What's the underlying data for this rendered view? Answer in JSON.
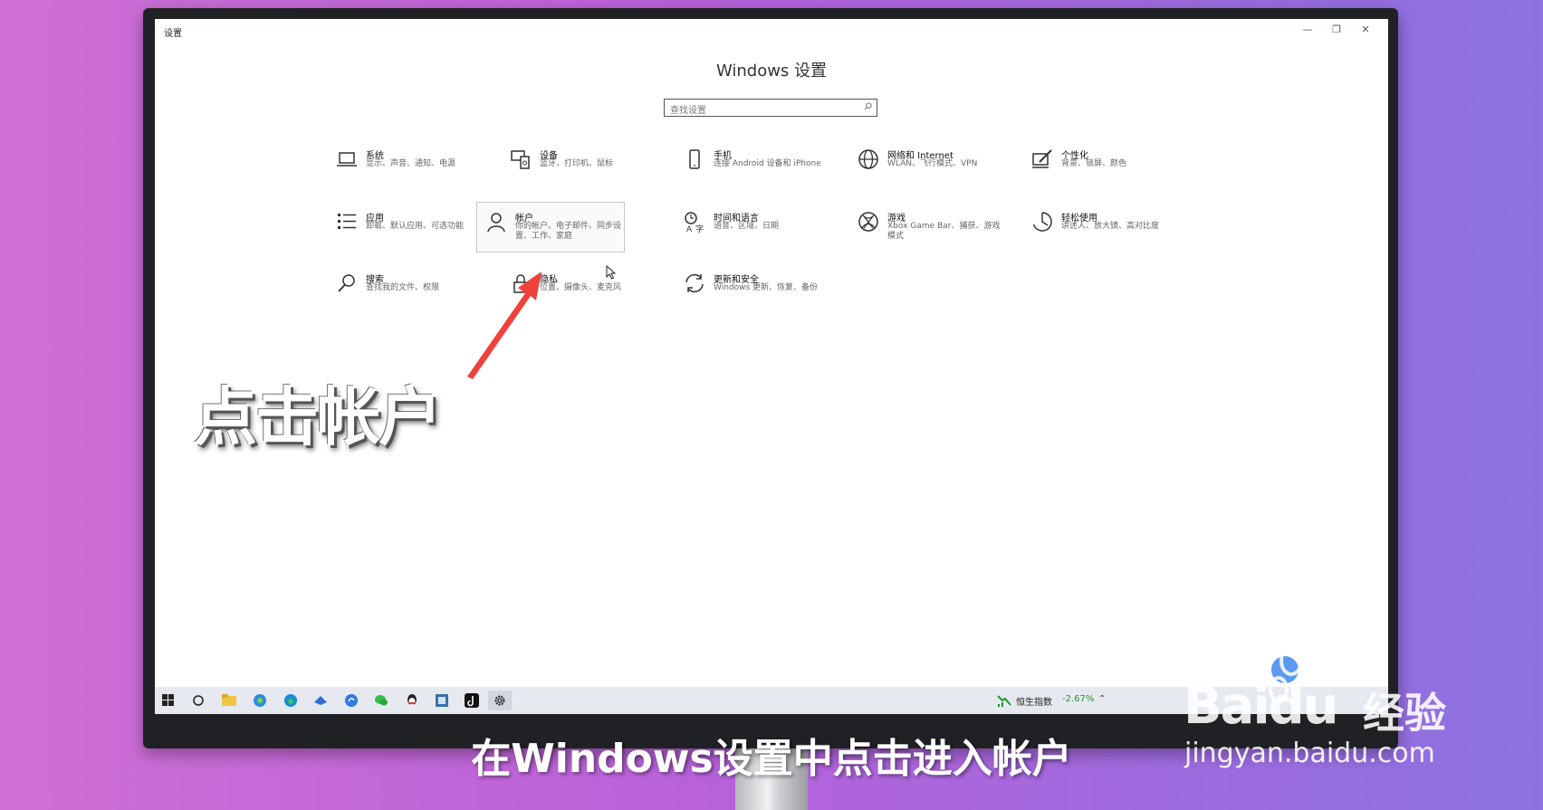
{
  "window": {
    "title": "设置",
    "heading": "Windows 设置",
    "minimize": "—",
    "maximize": "❐",
    "close": "✕"
  },
  "search": {
    "placeholder": "查找设置"
  },
  "tiles": [
    {
      "title": "系统",
      "desc": "显示、声音、通知、电源",
      "icon": "laptop-icon"
    },
    {
      "title": "设备",
      "desc": "蓝牙、打印机、鼠标",
      "icon": "devices-icon"
    },
    {
      "title": "手机",
      "desc": "连接 Android 设备和 iPhone",
      "icon": "phone-icon"
    },
    {
      "title": "网络和 Internet",
      "desc": "WLAN、飞行模式、VPN",
      "icon": "globe-icon"
    },
    {
      "title": "个性化",
      "desc": "背景、锁屏、颜色",
      "icon": "personalization-icon"
    },
    {
      "title": "应用",
      "desc": "卸载、默认应用、可选功能",
      "icon": "apps-list-icon"
    },
    {
      "title": "帐户",
      "desc": "你的帐户、电子邮件、同步设置、工作、家庭",
      "icon": "person-icon"
    },
    {
      "title": "时间和语言",
      "desc": "语音、区域、日期",
      "icon": "time-language-icon"
    },
    {
      "title": "游戏",
      "desc": "Xbox Game Bar、捕获、游戏模式",
      "icon": "xbox-icon"
    },
    {
      "title": "轻松使用",
      "desc": "讲述人、放大镜、高对比度",
      "icon": "ease-of-access-icon"
    },
    {
      "title": "搜索",
      "desc": "查找我的文件、权限",
      "icon": "search-icon"
    },
    {
      "title": "隐私",
      "desc": "位置、摄像头、麦克风",
      "icon": "lock-icon"
    },
    {
      "title": "更新和安全",
      "desc": "Windows 更新、恢复、备份",
      "icon": "update-icon"
    }
  ],
  "taskbar": {
    "stock_name": "恒生指数",
    "stock_change": "-2.67%",
    "icons": [
      "windows-start-icon",
      "cortana-icon",
      "file-explorer-icon",
      "browser-icon",
      "edge-icon",
      "app-icon",
      "app-icon",
      "wechat-icon",
      "qq-icon",
      "app-icon",
      "tiktok-icon",
      "settings-icon"
    ]
  },
  "overlay": {
    "annotation": "点击帐户",
    "subtitle": "在Windows设置中点击进入帐户",
    "watermark_logo": "Baidu",
    "watermark_cn": "经验",
    "watermark_url": "jingyan.baidu.com"
  },
  "colors": {
    "arrow": "#f0413a",
    "stock_down": "#1a9a2a",
    "taskbar": "#e6eaf0"
  }
}
